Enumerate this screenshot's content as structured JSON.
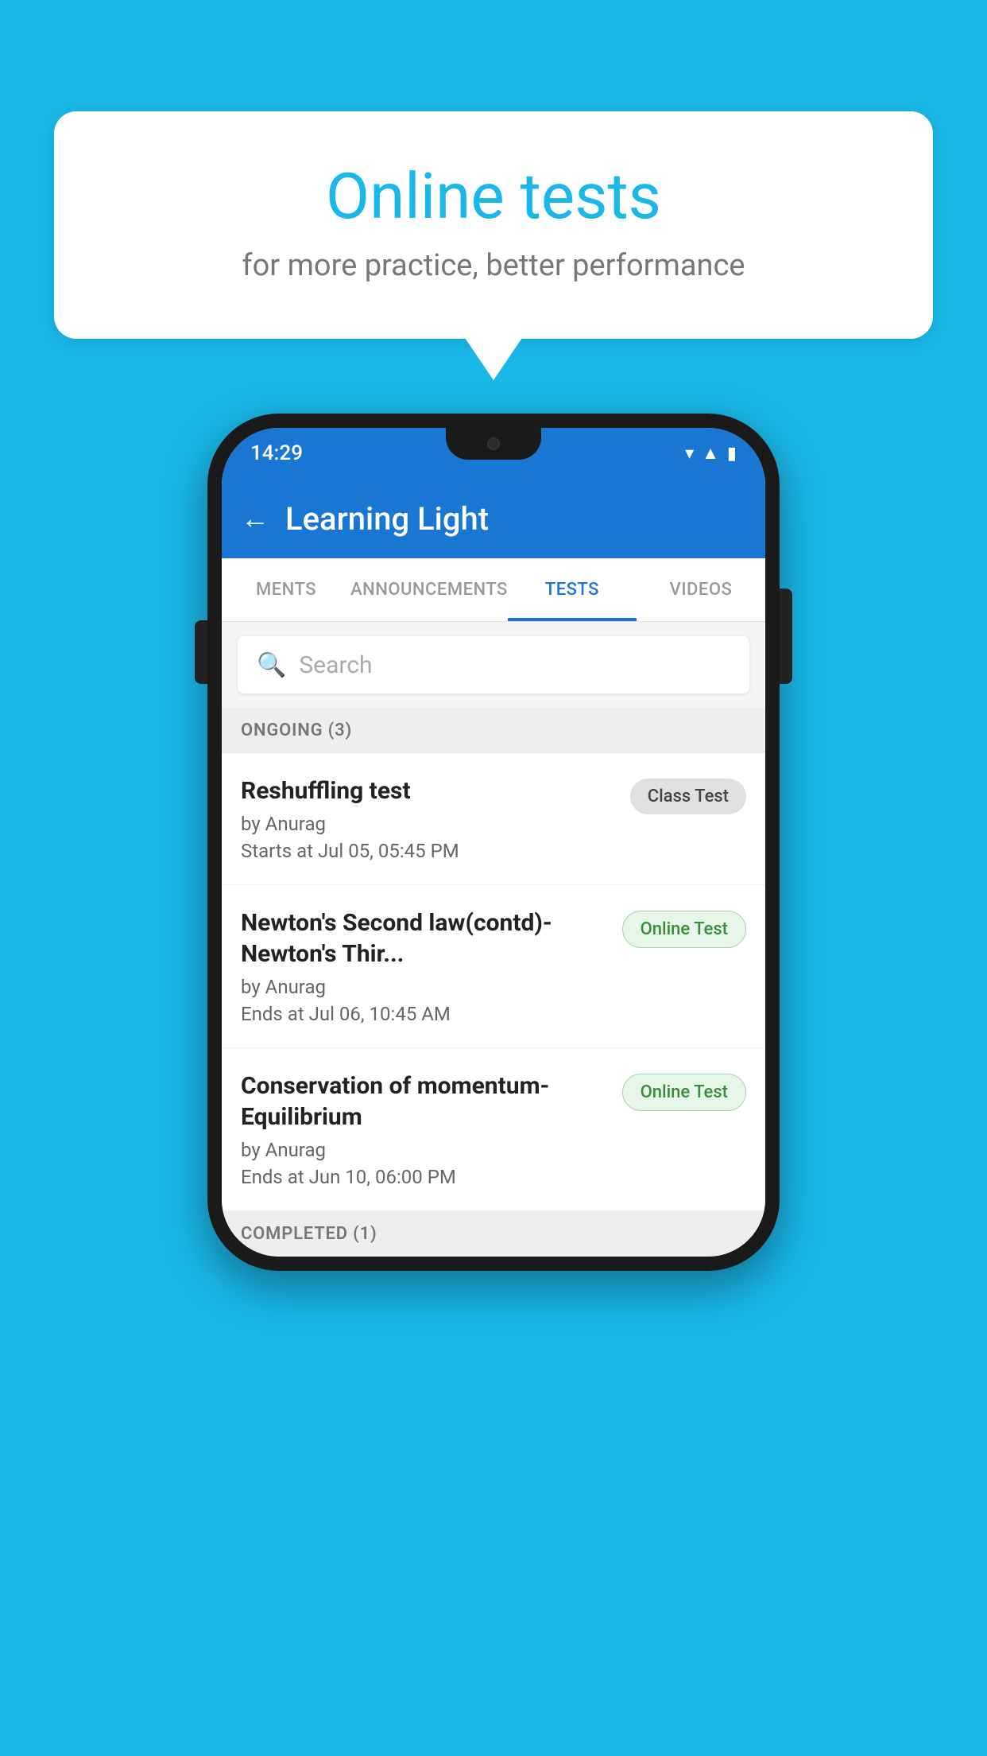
{
  "background_color": "#1ab8e8",
  "bubble": {
    "title": "Online tests",
    "subtitle": "for more practice, better performance"
  },
  "phone": {
    "status_bar": {
      "time": "14:29",
      "wifi": "▾",
      "signal": "▲",
      "battery": "▮"
    },
    "app_bar": {
      "title": "Learning Light",
      "back_label": "←"
    },
    "tabs": [
      {
        "label": "MENTS",
        "active": false
      },
      {
        "label": "ANNOUNCEMENTS",
        "active": false
      },
      {
        "label": "TESTS",
        "active": true
      },
      {
        "label": "VIDEOS",
        "active": false
      }
    ],
    "search": {
      "placeholder": "Search"
    },
    "sections": [
      {
        "header": "ONGOING (3)",
        "tests": [
          {
            "name": "Reshuffling test",
            "author": "by Anurag",
            "time_label": "Starts at",
            "time": "Jul 05, 05:45 PM",
            "badge": "Class Test",
            "badge_type": "class"
          },
          {
            "name": "Newton's Second law(contd)-Newton's Thir...",
            "author": "by Anurag",
            "time_label": "Ends at",
            "time": "Jul 06, 10:45 AM",
            "badge": "Online Test",
            "badge_type": "online"
          },
          {
            "name": "Conservation of momentum-Equilibrium",
            "author": "by Anurag",
            "time_label": "Ends at",
            "time": "Jun 10, 06:00 PM",
            "badge": "Online Test",
            "badge_type": "online"
          }
        ]
      },
      {
        "header": "COMPLETED (1)",
        "tests": []
      }
    ]
  }
}
